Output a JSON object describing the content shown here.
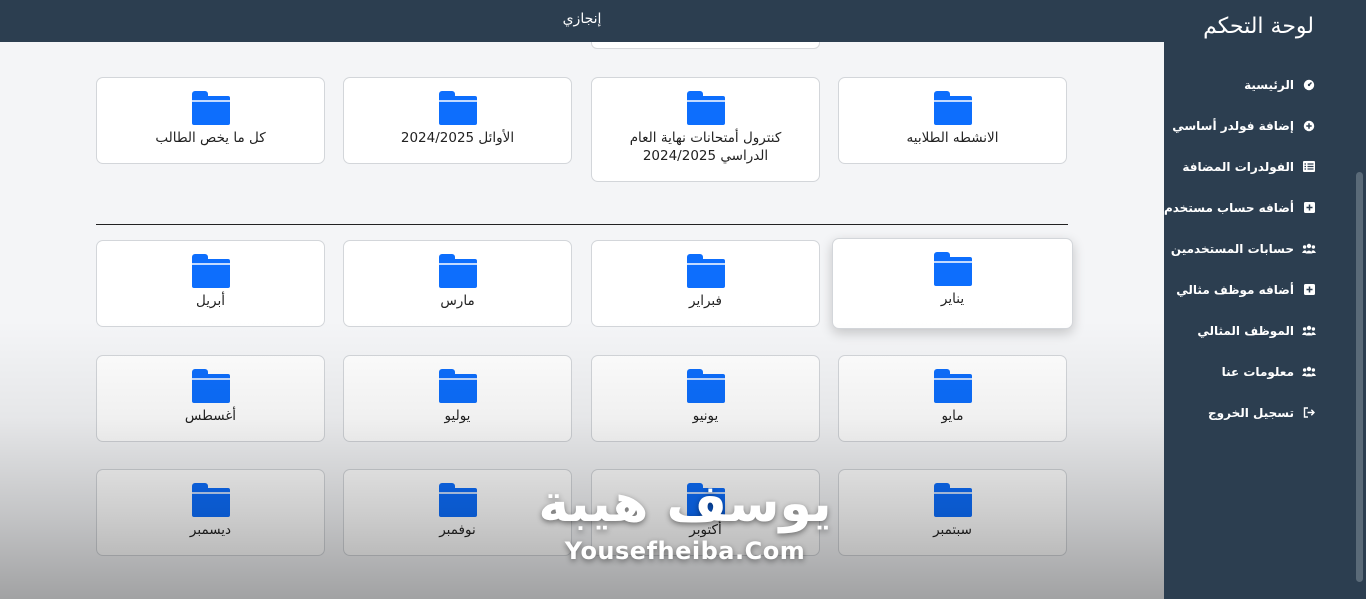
{
  "topbar": {
    "title": "إنجازي"
  },
  "sidebar": {
    "title": "لوحة التحكم",
    "items": [
      {
        "label": "الرئيسية",
        "icon": "dashboard-icon"
      },
      {
        "label": "إضافة فولدر أساسي",
        "icon": "plus-circle-icon"
      },
      {
        "label": "الفولدرات المضافة",
        "icon": "list-icon"
      },
      {
        "label": "أضافه حساب مستخدم",
        "icon": "plus-square-icon"
      },
      {
        "label": "حسابات المستخدمين",
        "icon": "users-icon"
      },
      {
        "label": "أضافه موظف مثالي",
        "icon": "plus-square-icon"
      },
      {
        "label": "الموظف المثالي",
        "icon": "users-icon"
      },
      {
        "label": "معلومات عنا",
        "icon": "users-icon"
      },
      {
        "label": "تسجيل الخروج",
        "icon": "logout-icon"
      }
    ]
  },
  "folders_top": [
    "الانشطه الطلابيه",
    "كنترول أمتحانات نهاية العام الدراسي 2024/2025",
    "الأوائل 2024/2025",
    "كل ما يخص الطالب"
  ],
  "months_row1": [
    "يناير",
    "فبراير",
    "مارس",
    "أبريل"
  ],
  "months_row2": [
    "مايو",
    "يونيو",
    "يوليو",
    "أغسطس"
  ],
  "months_row3": [
    "سبتمبر",
    "أكتوبر",
    "نوفمبر",
    "ديسمبر"
  ],
  "watermark": {
    "arabic": "يوسف هيبة",
    "latin": "Yousefheiba.Com"
  },
  "colors": {
    "sidebar_bg": "#2c3e50",
    "folder_icon": "#0d6efd",
    "content_bg": "#f4f5f7"
  }
}
